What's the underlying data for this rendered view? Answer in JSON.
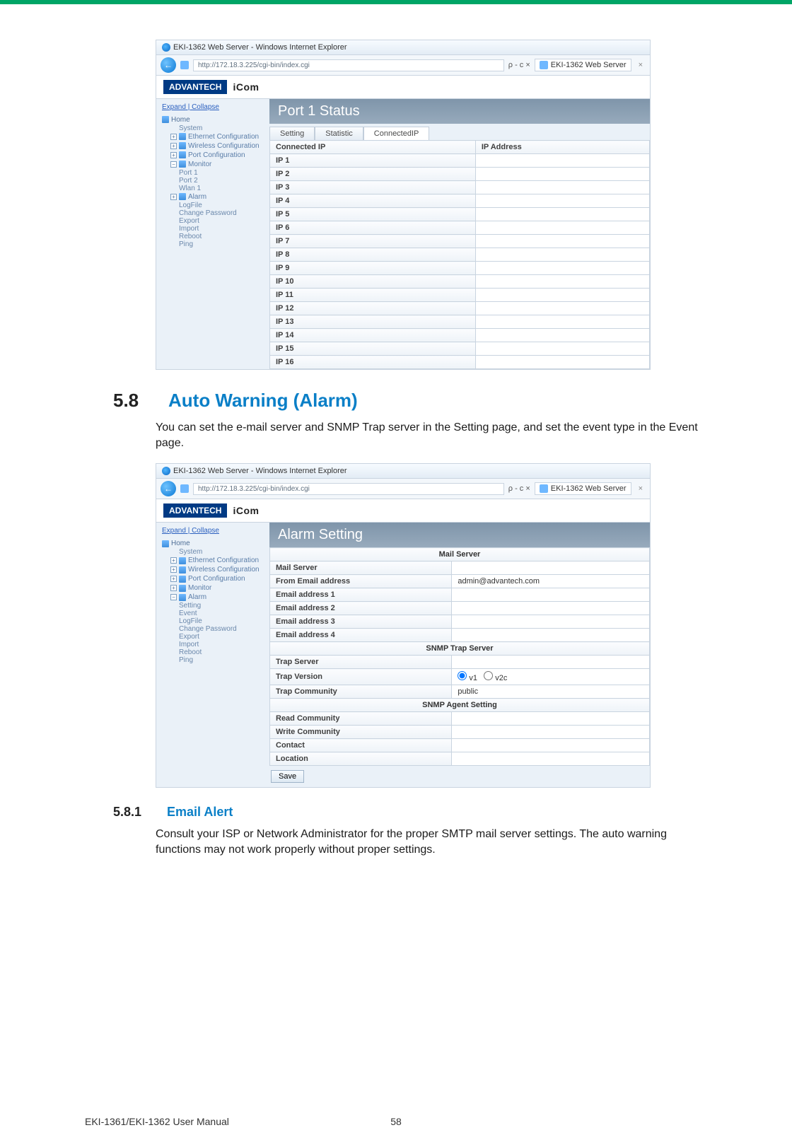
{
  "footer": {
    "left": "EKI-1361/EKI-1362 User Manual",
    "page": "58"
  },
  "section": {
    "num": "5.8",
    "title": "Auto Warning (Alarm)",
    "body": "You can set the e-mail server and SNMP Trap server in the Setting page, and set the event type in the Event page."
  },
  "subsection": {
    "num": "5.8.1",
    "title": "Email Alert",
    "body": "Consult your ISP or Network Administrator for the proper SMTP mail server settings. The auto warning functions may not work properly without proper settings."
  },
  "shot1": {
    "winTitle": "EKI-1362 Web Server - Windows Internet Explorer",
    "url": "http://172.18.3.225/cgi-bin/index.cgi",
    "searchRight": "ρ - c ×",
    "tab": "EKI-1362 Web Server",
    "brandA": "ADVANTECH",
    "brandB": "iCom",
    "expand": "Expand",
    "collapse": "Collapse",
    "tree": [
      "Home",
      "System",
      "Ethernet Configuration",
      "Wireless Configuration",
      "Port Configuration",
      "Monitor",
      "Port 1",
      "Port 2",
      "Wlan 1",
      "Alarm",
      "LogFile",
      "Change Password",
      "Export",
      "Import",
      "Reboot",
      "Ping"
    ],
    "main": {
      "title": "Port 1 Status",
      "tabs": [
        "Setting",
        "Statistic",
        "ConnectedIP"
      ],
      "headerA": "Connected IP",
      "headerB": "IP Address",
      "rows": [
        "IP 1",
        "IP 2",
        "IP 3",
        "IP 4",
        "IP 5",
        "IP 6",
        "IP 7",
        "IP 8",
        "IP 9",
        "IP 10",
        "IP 11",
        "IP 12",
        "IP 13",
        "IP 14",
        "IP 15",
        "IP 16"
      ]
    }
  },
  "shot2": {
    "winTitle": "EKI-1362 Web Server - Windows Internet Explorer",
    "url": "http://172.18.3.225/cgi-bin/index.cgi",
    "searchRight": "ρ - c ×",
    "tab": "EKI-1362 Web Server",
    "brandA": "ADVANTECH",
    "brandB": "iCom",
    "expand": "Expand",
    "collapse": "Collapse",
    "tree": [
      "Home",
      "System",
      "Ethernet Configuration",
      "Wireless Configuration",
      "Port Configuration",
      "Monitor",
      "Alarm",
      "Setting",
      "Event",
      "LogFile",
      "Change Password",
      "Export",
      "Import",
      "Reboot",
      "Ping"
    ],
    "main": {
      "title": "Alarm Setting",
      "sections": {
        "mail": "Mail Server",
        "snmpTrap": "SNMP Trap Server",
        "snmpAgent": "SNMP Agent Setting"
      },
      "rows": {
        "mailServer": "Mail Server",
        "fromEmail": "From Email address",
        "fromEmailVal": "admin@advantech.com",
        "email1": "Email address 1",
        "email2": "Email address 2",
        "email3": "Email address 3",
        "email4": "Email address 4",
        "trapServer": "Trap Server",
        "trapVersion": "Trap Version",
        "trapV1": "v1",
        "trapV2c": "v2c",
        "trapCommunity": "Trap Community",
        "trapCommunityVal": "public",
        "readCommunity": "Read Community",
        "writeCommunity": "Write Community",
        "contact": "Contact",
        "location": "Location"
      },
      "save": "Save"
    }
  }
}
